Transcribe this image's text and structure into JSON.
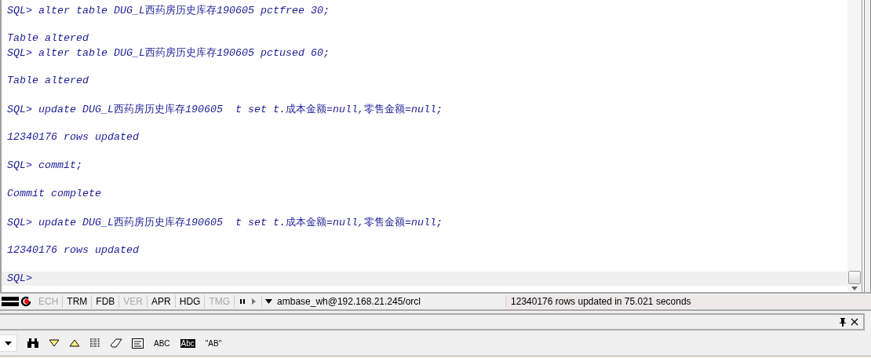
{
  "console": {
    "blocks": [
      {
        "lines": [
          {
            "text": "SQL> alter table DUG_L西药房历史库存190605 pctfree 30;",
            "current": false
          }
        ]
      },
      {
        "lines": [
          {
            "text": "Table altered",
            "current": false
          },
          {
            "text": "SQL> alter table DUG_L西药房历史库存190605 pctused 60;",
            "current": false
          }
        ]
      },
      {
        "lines": [
          {
            "text": "Table altered",
            "current": false
          }
        ]
      },
      {
        "lines": [
          {
            "text": "SQL> update DUG_L西药房历史库存190605  t set t.成本金额=null,零售金额=null;",
            "current": false
          }
        ]
      },
      {
        "lines": [
          {
            "text": "12340176 rows updated",
            "current": false
          }
        ]
      },
      {
        "lines": [
          {
            "text": "SQL> commit;",
            "current": false
          }
        ]
      },
      {
        "lines": [
          {
            "text": "Commit complete",
            "current": false
          }
        ]
      },
      {
        "lines": [
          {
            "text": "SQL> update DUG_L西药房历史库存190605  t set t.成本金额=null,零售金额=null;",
            "current": false
          }
        ]
      },
      {
        "lines": [
          {
            "text": "12340176 rows updated",
            "current": false
          }
        ]
      },
      {
        "lines": [
          {
            "text": "SQL>",
            "current": true
          }
        ]
      }
    ]
  },
  "status_bar": {
    "toggles": [
      {
        "label": "ECH",
        "disabled": true
      },
      {
        "label": "TRM",
        "disabled": false
      },
      {
        "label": "FDB",
        "disabled": false
      },
      {
        "label": "VER",
        "disabled": true
      },
      {
        "label": "APR",
        "disabled": false
      },
      {
        "label": "HDG",
        "disabled": false
      },
      {
        "label": "TMG",
        "disabled": true
      }
    ],
    "connection": "ambase_wh@192.168.21.245/orcl",
    "message": "12340176 rows updated in 75.021 seconds"
  },
  "find_toolbar": {
    "text_options": [
      {
        "label": "ABC",
        "inverted": false
      },
      {
        "label": "Abc",
        "inverted": true
      },
      {
        "label": "\"AB\"",
        "inverted": false
      }
    ]
  }
}
